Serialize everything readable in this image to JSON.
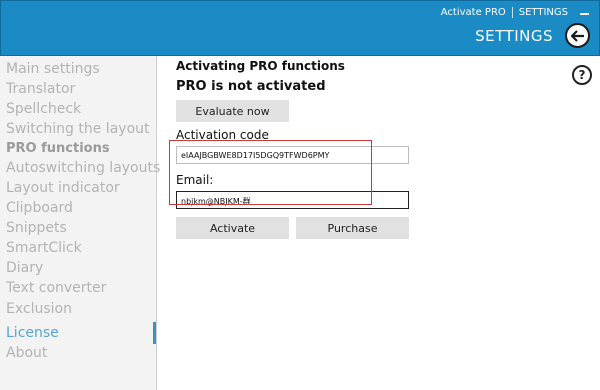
{
  "header": {
    "activate_pro": "Activate PRO",
    "settings_link": "SETTINGS",
    "title": "SETTINGS",
    "back_icon": "arrow-left-icon",
    "minimize_icon": "minimize-icon"
  },
  "sidebar": {
    "items": [
      {
        "label": "Main settings"
      },
      {
        "label": "Translator"
      },
      {
        "label": "Spellcheck"
      },
      {
        "label": "Switching the layout"
      },
      {
        "label": "PRO functions"
      },
      {
        "label": "Autoswitching layouts"
      },
      {
        "label": "Layout indicator"
      },
      {
        "label": "Clipboard"
      },
      {
        "label": "Snippets"
      },
      {
        "label": "SmartClick"
      },
      {
        "label": "Diary"
      },
      {
        "label": "Text converter"
      },
      {
        "label": "Exclusion"
      },
      {
        "label": "License"
      },
      {
        "label": "About"
      }
    ],
    "active_index": 13
  },
  "main": {
    "heading": "Activating PRO functions",
    "status": "PRO is not activated",
    "help_icon": "help-icon",
    "help_label": "?",
    "evaluate_label": "Evaluate now",
    "activation_code_label": "Activation code",
    "activation_code_value": "eIAAJBGBWE8D17I5DGQ9TFWD6PMY",
    "email_label": "Email:",
    "email_value": "nbjkm@NBJKM-群",
    "activate_label": "Activate",
    "purchase_label": "Purchase"
  },
  "colors": {
    "header": "#1a8bc4",
    "active_item": "#59a4d0",
    "highlight_border": "#c93b3b"
  }
}
